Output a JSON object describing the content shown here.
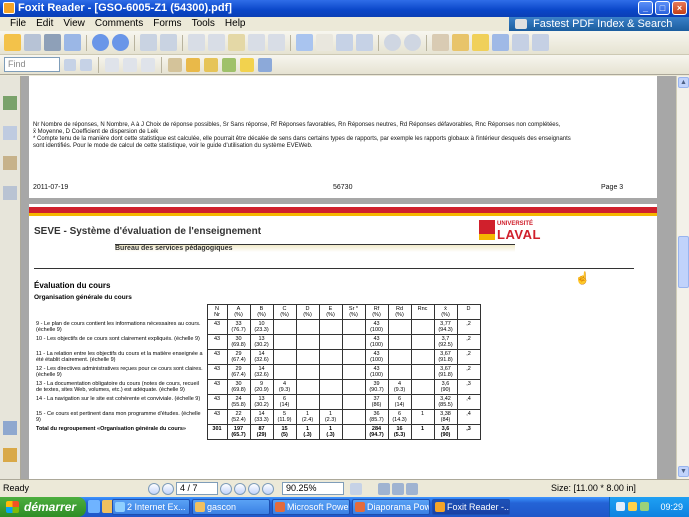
{
  "window": {
    "title": "Foxit Reader - [GSO-6005-Z1 (54300).pdf]",
    "controls": [
      "_",
      "□",
      "×"
    ]
  },
  "menu": [
    "File",
    "Edit",
    "View",
    "Comments",
    "Forms",
    "Tools",
    "Help"
  ],
  "ad_banner": "Fastest PDF Index & Search",
  "find": {
    "placeholder": "Find"
  },
  "page1": {
    "legend_line1": "Nr  Nombre de réponses, N  Nombre, A à J  Choix de réponse possibles, Sr  Sans réponse, Rf  Réponses favorables, Rn  Réponses neutres, Rd  Réponses défavorables, Rnc  Réponses non complétées,",
    "legend_line2": "x̄  Moyenne, D  Coefficient de dispersion de Leik",
    "legend_line3": "* Compte tenu de la manière dont cette statistique est calculée, elle pourrait être décalée de sens dans certains types de rapports, par exemple les rapports globaux à l'intérieur desquels des enseignants",
    "legend_line4": "sont identifiés.  Pour le mode de calcul de cette statistique, voir le guide d'utilisation du système EVEWeb.",
    "date": "2011-07-19",
    "code": "56730",
    "page": "Page  3"
  },
  "page2": {
    "title": "SEVE - Système d'évaluation de l'enseignement",
    "subtitle": "Bureau des services pédagogiques",
    "logo_small": "UNIVERSITÉ",
    "logo_big": "LAVAL",
    "section": "Évaluation du cours",
    "subsection": "Organisation générale du cours"
  },
  "table": {
    "header_nr": "Nr",
    "header_n": "N",
    "columns": [
      {
        "letter": "A",
        "unit": "(%)"
      },
      {
        "letter": "B",
        "unit": "(%)"
      },
      {
        "letter": "C",
        "unit": "(%)"
      },
      {
        "letter": "D",
        "unit": "(%)"
      },
      {
        "letter": "E",
        "unit": "(%)"
      },
      {
        "letter": "Sr *",
        "unit": "(%)"
      },
      {
        "letter": "Rf",
        "unit": "(%)"
      },
      {
        "letter": "Rd",
        "unit": "(%)"
      },
      {
        "letter": "Rnc",
        "unit": ""
      },
      {
        "letter": "x̄",
        "unit": "(%)"
      },
      {
        "letter": "D",
        "unit": ""
      }
    ],
    "rows": [
      {
        "q": "9 - Le plan de cours contient les informations nécessaires au cours. (échelle 9)",
        "n": "43",
        "v": [
          "33\n(76.7)",
          "10\n(23.3)",
          "",
          "",
          "",
          "",
          "43\n(100)",
          "",
          "",
          "3,77\n(94.3)",
          ",2"
        ]
      },
      {
        "q": "10 - Les objectifs de ce cours sont clairement expliqués. (échelle 9)",
        "n": "43",
        "v": [
          "30\n(69.8)",
          "13\n(30.2)",
          "",
          "",
          "",
          "",
          "43\n(100)",
          "",
          "",
          "3,7\n(92.5)",
          ",2"
        ]
      },
      {
        "q": "11 - La relation entre les objectifs du cours et la matière enseignée a été établit clairement. (échelle 9)",
        "n": "43",
        "v": [
          "29\n(67.4)",
          "14\n(32.6)",
          "",
          "",
          "",
          "",
          "43\n(100)",
          "",
          "",
          "3,67\n(91.8)",
          ",2"
        ]
      },
      {
        "q": "12 - Les directives administratives reçues pour ce cours sont claires. (échelle 9)",
        "n": "43",
        "v": [
          "29\n(67.4)",
          "14\n(32.6)",
          "",
          "",
          "",
          "",
          "43\n(100)",
          "",
          "",
          "3,67\n(91.8)",
          ",2"
        ]
      },
      {
        "q": "13 - La documentation obligatoire du cours (notes de cours, recueil de textes, sites Web, volumes, etc.) est adéquate. (échelle 9)",
        "n": "43",
        "v": [
          "30\n(69.8)",
          "9\n(20.9)",
          "4\n(9.3)",
          "",
          "",
          "",
          "39\n(90.7)",
          "4\n(9.3)",
          "",
          "3,6\n(90)",
          ",3"
        ]
      },
      {
        "q": "14 - La navigation sur le site est cohérente et conviviale. (échelle 9)",
        "n": "43",
        "v": [
          "24\n(55.8)",
          "13\n(30.2)",
          "6\n(14)",
          "",
          "",
          "",
          "37\n(86)",
          "6\n(14)",
          "",
          "3,42\n(85.5)",
          ",4"
        ]
      },
      {
        "q": "15 - Ce cours est pertinent dans mon programme d'études. (échelle 9)",
        "n": "43",
        "v": [
          "22\n(52.4)",
          "14\n(33.3)",
          "5\n(11.9)",
          "1\n(2.4)",
          "1\n(2.3)",
          "",
          "36\n(85.7)",
          "6\n(14.3)",
          "1",
          "3,38\n(84)",
          ",4"
        ]
      },
      {
        "q": "Total du regroupement «Organisation générale du cours»",
        "n": "301",
        "v": [
          "197\n(65.7)",
          "87\n(29)",
          "15\n(5)",
          "1\n(.3)",
          "1\n(.3)",
          "",
          "284\n(94.7)",
          "16\n(5.3)",
          "1",
          "3,6\n(90)",
          ",3"
        ],
        "total": true
      }
    ]
  },
  "status": {
    "ready": "Ready",
    "page": "4 / 7",
    "zoom": "90.25%",
    "size": "Size: [11.00 * 8.00 in]"
  },
  "taskbar": {
    "start": "démarrer",
    "tasks": [
      "2 Internet Ex...",
      "gascon",
      "Microsoft Powe...",
      "Diaporama Pow...",
      "Foxit Reader -..."
    ],
    "clock": "09:29"
  }
}
